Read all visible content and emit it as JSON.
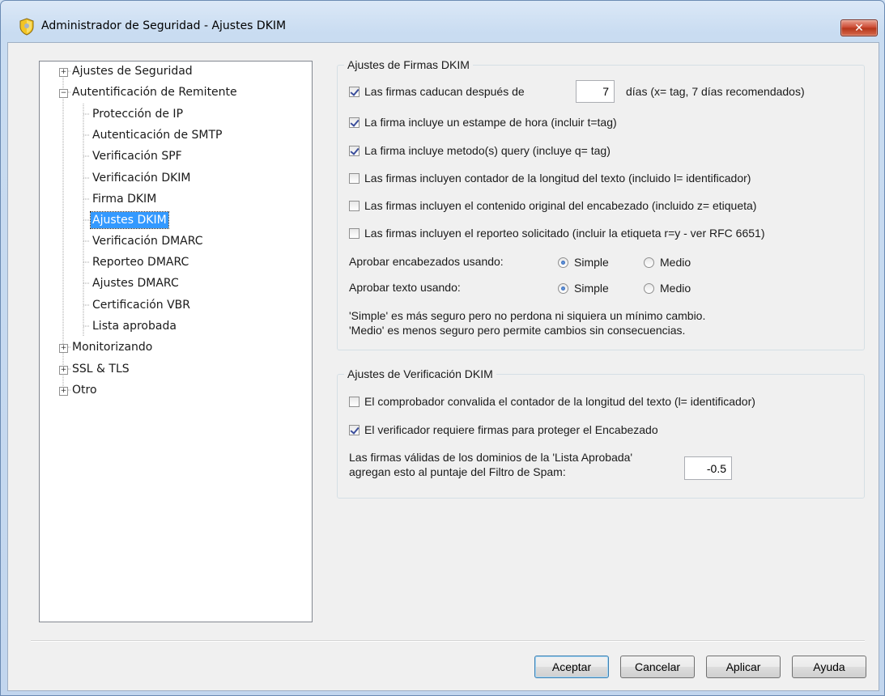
{
  "window": {
    "title": "Administrador de Seguridad - Ajustes DKIM",
    "close_label": "✕"
  },
  "tree": {
    "items": [
      {
        "label": "Ajustes de Seguridad",
        "expander": "+"
      },
      {
        "label": "Autentificación de Remitente",
        "expander": "−"
      },
      {
        "label": "Protección de IP"
      },
      {
        "label": "Autenticación de SMTP"
      },
      {
        "label": "Verificación SPF"
      },
      {
        "label": "Verificación DKIM"
      },
      {
        "label": "Firma DKIM"
      },
      {
        "label": "Ajustes DKIM",
        "selected": true
      },
      {
        "label": "Verificación DMARC"
      },
      {
        "label": "Reporteo DMARC"
      },
      {
        "label": "Ajustes DMARC"
      },
      {
        "label": "Certificación VBR"
      },
      {
        "label": "Lista aprobada"
      },
      {
        "label": "Monitorizando",
        "expander": "+"
      },
      {
        "label": "SSL & TLS",
        "expander": "+"
      },
      {
        "label": "Otro",
        "expander": "+"
      }
    ]
  },
  "signing": {
    "title": "Ajustes de Firmas DKIM",
    "expire_label": "Las firmas caducan después de",
    "expire_value": "7",
    "expire_suffix": "días (x= tag, 7 días recomendados)",
    "expire_checked": true,
    "options": [
      {
        "label": "La firma incluye un estampe de hora (incluir t=tag)",
        "checked": true
      },
      {
        "label": "La firma incluye metodo(s) query (incluye q= tag)",
        "checked": true
      },
      {
        "label": "Las firmas incluyen contador de la longitud del texto (incluido l= identificador)",
        "checked": false
      },
      {
        "label": "Las firmas incluyen el contenido original del encabezado (incluido z= etiqueta)",
        "checked": false
      },
      {
        "label": "Las firmas incluyen el reporteo solicitado (incluir la etiqueta r=y - ver RFC 6651)",
        "checked": false
      }
    ],
    "canon_headers_label": "Aprobar encabezados usando:",
    "canon_body_label": "Aprobar texto usando:",
    "simple_label": "Simple",
    "medio_label": "Medio",
    "headers_selected": "Simple",
    "body_selected": "Simple",
    "note_line1": "'Simple' es más seguro pero no perdona ni siquiera un mínimo cambio.",
    "note_line2": "'Medio' es menos seguro pero permite cambios sin consecuencias."
  },
  "verification": {
    "title": "Ajustes de Verificación DKIM",
    "options": [
      {
        "label": "El comprobador convalida el contador de la longitud del texto (l= identificador)",
        "checked": false
      },
      {
        "label": "El verificador requiere firmas para proteger el Encabezado",
        "checked": true
      }
    ],
    "score_line1": "Las firmas válidas de los dominios de la 'Lista Aprobada'",
    "score_line2": "agregan esto al puntaje del Filtro de Spam:",
    "score_value": "-0.5"
  },
  "buttons": {
    "ok": "Aceptar",
    "cancel": "Cancelar",
    "apply": "Aplicar",
    "help": "Ayuda"
  }
}
